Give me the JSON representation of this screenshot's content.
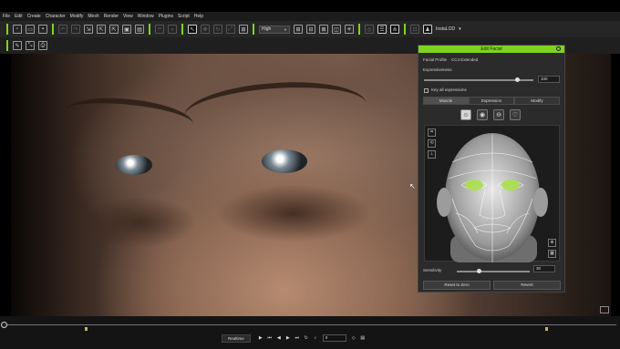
{
  "menubar": {
    "items": [
      "File",
      "Edit",
      "Create",
      "Character",
      "Modify",
      "Mesh",
      "Render",
      "View",
      "Window",
      "Plugins",
      "Script",
      "Help"
    ]
  },
  "toolbar": {
    "quality_select": "High",
    "layout_label": "InstaLOD"
  },
  "edit_facial": {
    "title": "Edit Facial",
    "facial_profile_label": "Facial Profile",
    "facial_profile_value": "CC4 Extended",
    "expressiveness_label": "Expressiveness",
    "expressiveness_value": "100",
    "expressiveness_level": 0.85,
    "key_all_label": "Key all expressions",
    "tabs": [
      "Muscle",
      "Expression",
      "Modify"
    ],
    "sensitivity_label": "Sensitivity",
    "sensitivity_value": "30",
    "sensitivity_level": 0.3,
    "reset_button": "Reset to Zero",
    "revert_button": "Revert",
    "accent_color": "#7fd320"
  },
  "timeline": {
    "mode_label": "Realtime",
    "frame_value": "0"
  }
}
